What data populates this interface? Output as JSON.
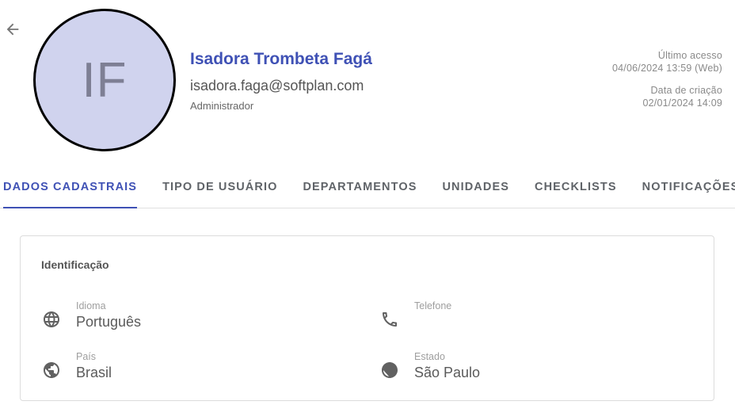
{
  "user": {
    "initials": "IF",
    "name": "Isadora Trombeta Fagá",
    "email": "isadora.faga@softplan.com",
    "role": "Administrador"
  },
  "meta": {
    "last_access_label": "Último acesso",
    "last_access_value": "04/06/2024 13:59 (Web)",
    "created_label": "Data de criação",
    "created_value": "02/01/2024 14:09"
  },
  "tabs": [
    {
      "label": "DADOS CADASTRAIS",
      "active": true
    },
    {
      "label": "TIPO DE USUÁRIO"
    },
    {
      "label": "DEPARTAMENTOS"
    },
    {
      "label": "UNIDADES"
    },
    {
      "label": "CHECKLISTS"
    },
    {
      "label": "NOTIFICAÇÕES"
    }
  ],
  "card": {
    "title": "Identificação",
    "fields": [
      {
        "label": "Idioma",
        "value": "Português",
        "icon": "globe-icon"
      },
      {
        "label": "Telefone",
        "value": "",
        "icon": "phone-icon"
      },
      {
        "label": "País",
        "value": "Brasil",
        "icon": "earth-icon"
      },
      {
        "label": "Estado",
        "value": "São Paulo",
        "icon": "earth-icon"
      }
    ]
  },
  "colors": {
    "accent": "#3f51b5",
    "avatar_bg": "#d0d3ee",
    "icon": "#616161"
  }
}
